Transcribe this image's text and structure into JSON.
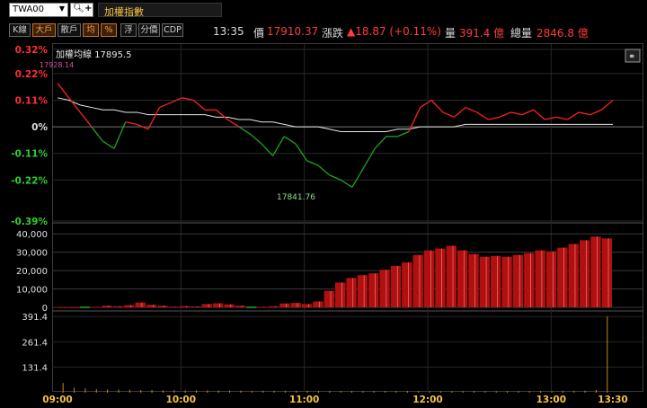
{
  "header": {
    "symbol": "TWA00",
    "title": "加權指數"
  },
  "toolbar": {
    "buttons": [
      {
        "label": "K線",
        "active": false
      },
      {
        "label": "大戶",
        "active": true
      },
      {
        "label": "散戶",
        "active": false
      },
      {
        "label": "均",
        "active": true
      },
      {
        "label": "%",
        "active": true
      },
      {
        "label": "浮",
        "active": false
      },
      {
        "label": "分價",
        "active": false
      },
      {
        "label": "CDP",
        "active": false
      }
    ]
  },
  "quote": {
    "time": "13:35",
    "price_label": "價",
    "price": "17910.37",
    "change_label": "漲跌",
    "change": "▲18.87 (+0.11%)",
    "volume_label": "量",
    "volume": "391.4 億",
    "total_label": "總量",
    "total": "2846.8 億"
  },
  "colors": {
    "up": "#ff2020",
    "down": "#1fa31f",
    "avg": "#e8e8e8",
    "bar_up": "#b01010",
    "bar_down": "#1e7a1e",
    "vol": "#c88a1a",
    "accent": "#f5c242"
  },
  "chart_data": [
    {
      "type": "line",
      "series": [
        {
          "name": "加權指數",
          "values_pct": [
            0.18,
            0.12,
            0.06,
            0.0,
            -0.06,
            -0.09,
            0.02,
            0.01,
            -0.01,
            0.08,
            0.1,
            0.12,
            0.11,
            0.07,
            0.07,
            0.03,
            0.0,
            -0.03,
            -0.07,
            -0.12,
            -0.04,
            -0.07,
            -0.14,
            -0.16,
            -0.2,
            -0.22,
            -0.25,
            -0.17,
            -0.09,
            -0.04,
            -0.04,
            -0.02,
            0.08,
            0.11,
            0.06,
            0.04,
            0.08,
            0.06,
            0.03,
            0.04,
            0.06,
            0.05,
            0.07,
            0.03,
            0.04,
            0.03,
            0.06,
            0.05,
            0.07,
            0.11
          ]
        },
        {
          "name": "加權均線",
          "values_pct": [
            0.12,
            0.11,
            0.09,
            0.08,
            0.07,
            0.07,
            0.06,
            0.06,
            0.05,
            0.05,
            0.05,
            0.05,
            0.05,
            0.05,
            0.04,
            0.04,
            0.03,
            0.03,
            0.02,
            0.02,
            0.01,
            0.0,
            0.0,
            -0.0,
            -0.01,
            -0.02,
            -0.02,
            -0.02,
            -0.02,
            -0.02,
            -0.01,
            -0.01,
            0.0,
            0.0,
            0.0,
            0.0,
            0.01,
            0.01,
            0.01,
            0.01,
            0.01,
            0.01,
            0.01,
            0.01,
            0.01,
            0.01,
            0.01,
            0.01,
            0.01,
            0.01
          ]
        }
      ],
      "x_ticks": [
        "09:00",
        "10:00",
        "11:00",
        "12:00",
        "13:00",
        "13:30"
      ],
      "y_ticks_left": [
        "0.32%",
        "0.22%",
        "0.11%",
        "0%",
        "-0.11%",
        "-0.22%",
        "-0.39%"
      ],
      "ylim_pct": [
        -0.39,
        0.32
      ],
      "legend": "加權均線 17895.5",
      "annotations": [
        {
          "text": "17928.14",
          "kind": "high"
        },
        {
          "text": "17841.76",
          "kind": "low"
        }
      ]
    },
    {
      "type": "bar",
      "y_ticks": [
        "40,000",
        "30,000",
        "20,000",
        "10,000",
        "0"
      ],
      "ylim": [
        0,
        45000
      ],
      "values": [
        120,
        80,
        -200,
        300,
        900,
        600,
        1200,
        2600,
        1400,
        900,
        400,
        700,
        500,
        1800,
        2200,
        1600,
        900,
        -400,
        300,
        600,
        2100,
        2400,
        1800,
        3200,
        9000,
        13500,
        16000,
        17500,
        18500,
        20500,
        22500,
        24500,
        28500,
        31000,
        32000,
        33500,
        31000,
        29000,
        27500,
        28000,
        27500,
        28500,
        29500,
        31000,
        30500,
        32500,
        34500,
        36500,
        38500,
        37500
      ]
    },
    {
      "type": "bar",
      "y_ticks": [
        "391.4",
        "261.4",
        "131.4"
      ],
      "ylim": [
        0,
        420
      ],
      "values": [
        50,
        26,
        22,
        18,
        17,
        16,
        15,
        14,
        14,
        13,
        13,
        12,
        12,
        12,
        11,
        11,
        11,
        10,
        10,
        10,
        10,
        10,
        10,
        9,
        9,
        9,
        9,
        9,
        9,
        9,
        9,
        9,
        9,
        8,
        8,
        8,
        8,
        8,
        8,
        8,
        8,
        8,
        9,
        9,
        9,
        10,
        10,
        11,
        14,
        391.4
      ]
    }
  ]
}
